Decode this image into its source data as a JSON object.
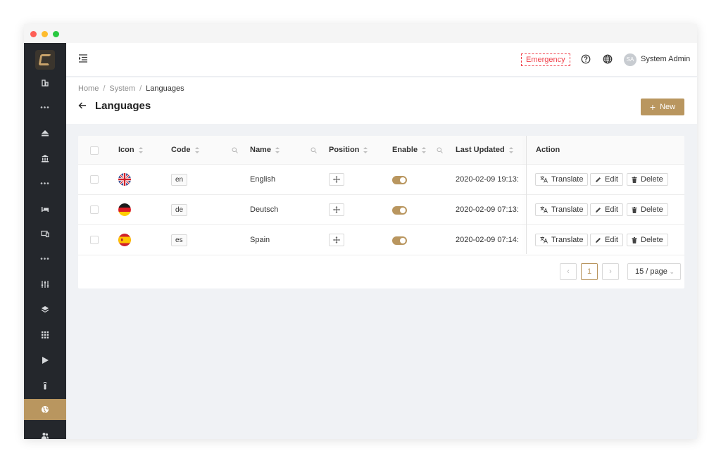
{
  "window": {
    "controls": [
      "close",
      "minimize",
      "maximize"
    ]
  },
  "sidebar": {
    "items": [
      {
        "icon": "import-icon",
        "active": false
      },
      {
        "icon": "more-icon",
        "active": false
      },
      {
        "icon": "eject-icon",
        "active": false
      },
      {
        "icon": "bank-icon",
        "active": false
      },
      {
        "icon": "more-icon",
        "active": false
      },
      {
        "icon": "bed-icon",
        "active": false
      },
      {
        "icon": "devices-icon",
        "active": false
      },
      {
        "icon": "more-icon",
        "active": false
      },
      {
        "icon": "sliders-icon",
        "active": false
      },
      {
        "icon": "layers-icon",
        "active": false
      },
      {
        "icon": "apps-grid-icon",
        "active": false
      },
      {
        "icon": "play-icon",
        "active": false
      },
      {
        "icon": "remote-icon",
        "active": false
      },
      {
        "icon": "globe-icon",
        "active": true
      },
      {
        "icon": "users-icon",
        "active": false
      }
    ],
    "accent": "#b9965f",
    "background": "#24272c"
  },
  "topbar": {
    "emergency_label": "Emergency",
    "user_initials": "SA",
    "user_name": "System Admin"
  },
  "breadcrumb": {
    "items": [
      "Home",
      "System",
      "Languages"
    ]
  },
  "page": {
    "title": "Languages",
    "new_button": "New"
  },
  "table": {
    "columns": {
      "icon": "Icon",
      "code": "Code",
      "name": "Name",
      "position": "Position",
      "enable": "Enable",
      "last_updated": "Last Updated",
      "action": "Action"
    },
    "rows": [
      {
        "flag": "uk",
        "code": "en",
        "name": "English",
        "enabled": true,
        "last_updated": "2020-02-09 19:13:"
      },
      {
        "flag": "de",
        "code": "de",
        "name": "Deutsch",
        "enabled": true,
        "last_updated": "2020-02-09 07:13:"
      },
      {
        "flag": "es",
        "code": "es",
        "name": "Spain",
        "enabled": true,
        "last_updated": "2020-02-09 07:14:"
      }
    ],
    "actions": {
      "translate": "Translate",
      "edit": "Edit",
      "delete": "Delete"
    }
  },
  "pagination": {
    "current_page": "1",
    "page_size": "15 / page"
  },
  "colors": {
    "accent": "#b9965f",
    "emergency": "#f0404a"
  }
}
